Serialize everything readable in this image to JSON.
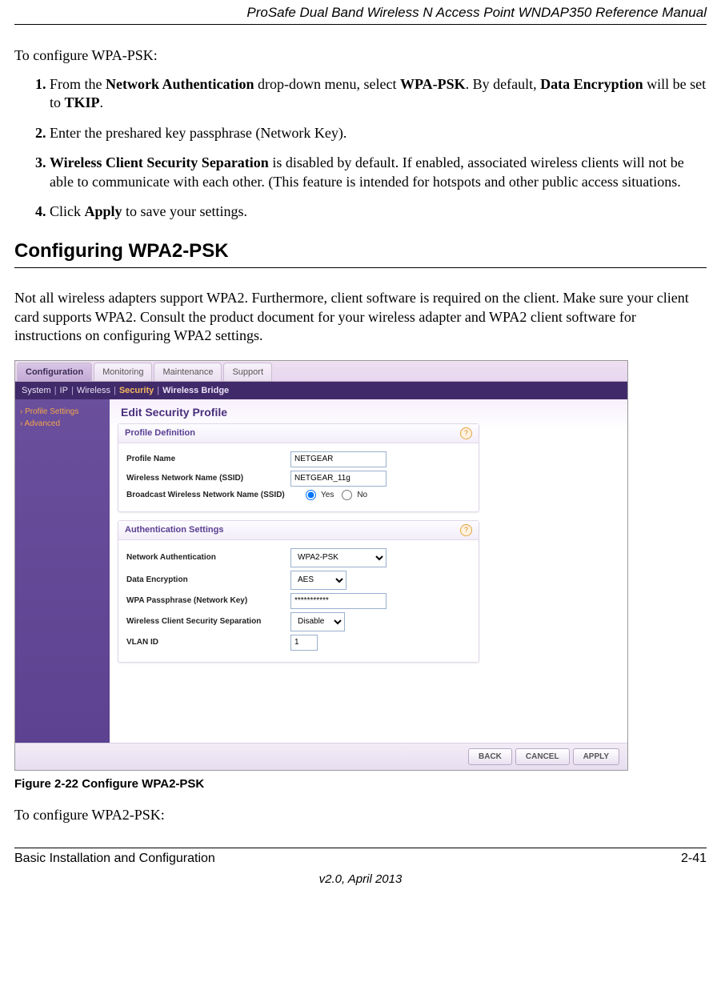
{
  "header": {
    "title": "ProSafe Dual Band Wireless N Access Point WNDAP350 Reference Manual"
  },
  "intro": "To configure WPA-PSK:",
  "steps": {
    "s1": {
      "prefix": "From the ",
      "b1": "Network Authentication",
      "mid1": " drop-down menu, select ",
      "b2": "WPA-PSK",
      "mid2": ". By default, ",
      "b3": "Data Encryption",
      "mid3": " will be set to ",
      "b4": "TKIP",
      "suffix": "."
    },
    "s2": "Enter the preshared key passphrase (Network Key).",
    "s3": {
      "b1": "Wireless Client Security Separation",
      "rest": " is disabled by default. If enabled, associated wireless clients will not be able to communicate with each other. (This feature is intended for hotspots and other public access situations."
    },
    "s4": {
      "prefix": "Click ",
      "b1": "Apply",
      "suffix": " to save your settings."
    }
  },
  "section_heading": "Configuring WPA2-PSK",
  "section_body": "Not all wireless adapters support WPA2. Furthermore, client software is required on the client. Make sure your client card supports WPA2. Consult the product document for your wireless adapter and WPA2 client software for instructions on configuring WPA2 settings.",
  "ui": {
    "tabs": {
      "t1": "Configuration",
      "t2": "Monitoring",
      "t3": "Maintenance",
      "t4": "Support"
    },
    "subnav": {
      "n1": "System",
      "n2": "IP",
      "n3": "Wireless",
      "n4": "Security",
      "n5": "Wireless Bridge"
    },
    "sidebar": {
      "s1": "› Profile Settings",
      "s2": "› Advanced"
    },
    "panel_title": "Edit Security Profile",
    "box1": {
      "header": "Profile Definition",
      "r1": {
        "label": "Profile Name",
        "value": "NETGEAR"
      },
      "r2": {
        "label": "Wireless Network Name (SSID)",
        "value": "NETGEAR_11g"
      },
      "r3": {
        "label": "Broadcast Wireless Network Name (SSID)",
        "yes": "Yes",
        "no": "No"
      }
    },
    "box2": {
      "header": "Authentication Settings",
      "r1": {
        "label": "Network Authentication",
        "value": "WPA2-PSK"
      },
      "r2": {
        "label": "Data Encryption",
        "value": "AES"
      },
      "r3": {
        "label": "WPA Passphrase (Network Key)",
        "value": "***********"
      },
      "r4": {
        "label": "Wireless Client Security Separation",
        "value": "Disable"
      },
      "r5": {
        "label": "VLAN ID",
        "value": "1"
      }
    },
    "buttons": {
      "back": "BACK",
      "cancel": "CANCEL",
      "apply": "APPLY"
    }
  },
  "fig_caption": "Figure 2-22  Configure WPA2-PSK",
  "after_fig": "To configure WPA2-PSK:",
  "footer": {
    "left": "Basic Installation and Configuration",
    "right": "2-41",
    "center": "v2.0, April 2013"
  }
}
